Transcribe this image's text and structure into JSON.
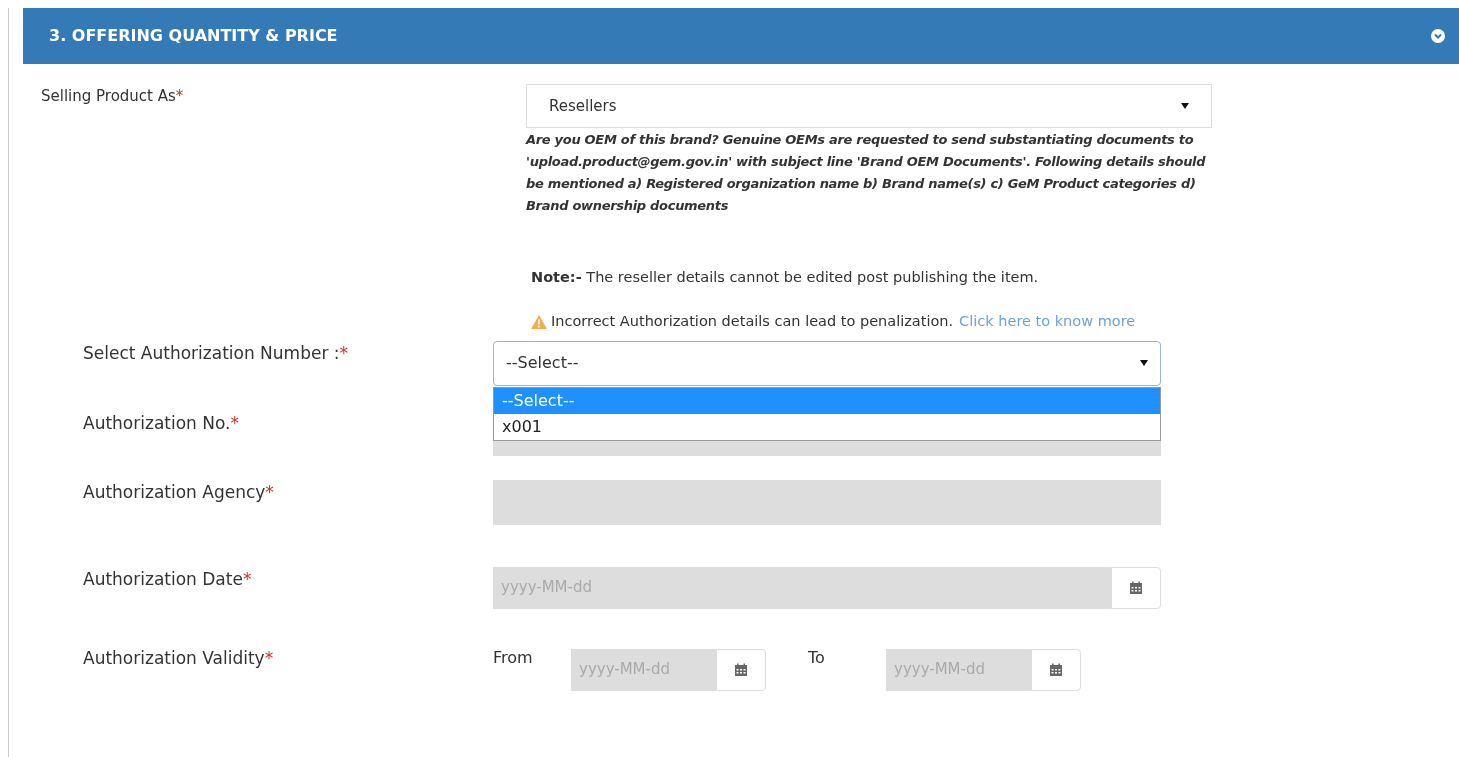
{
  "section": {
    "title": "3. OFFERING QUANTITY & PRICE"
  },
  "selling_product_as": {
    "label": "Selling Product As",
    "required_mark": "*",
    "value": "Resellers",
    "oem_notice": "Are you OEM of this brand? Genuine OEMs are requested to send substantiating documents to 'upload.product@gem.gov.in' with subject line 'Brand OEM Documents'. Following details should be mentioned a) Registered organization name b) Brand name(s) c) GeM Product categories d) Brand ownership documents"
  },
  "note": "**Note:-** The reseller details cannot be edited post publishing the item.",
  "warning": {
    "text": "Incorrect Authorization details can lead to penalization.",
    "link": "Click here to know more"
  },
  "fields": [
    {
      "kind": "select",
      "label": "Select Authorization Number :",
      "required_mark": "*",
      "value": "--Select--",
      "expanded": true,
      "options": [
        {
          "label": "--Select--",
          "selected": true
        },
        {
          "label": "x001",
          "selected": false
        }
      ]
    },
    {
      "kind": "text",
      "label": "Authorization No.",
      "required_mark": "*"
    },
    {
      "kind": "text",
      "label": "Authorization Agency",
      "required_mark": "*"
    },
    {
      "kind": "date",
      "label": "Authorization Date",
      "required_mark": "*",
      "placeholder": "yyyy-MM-dd"
    },
    {
      "kind": "date_range",
      "label": "Authorization Validity",
      "required_mark": "*",
      "from_label": "From",
      "from_placeholder": "yyyy-MM-dd",
      "to_label": "To",
      "to_placeholder": "yyyy-MM-dd"
    }
  ]
}
